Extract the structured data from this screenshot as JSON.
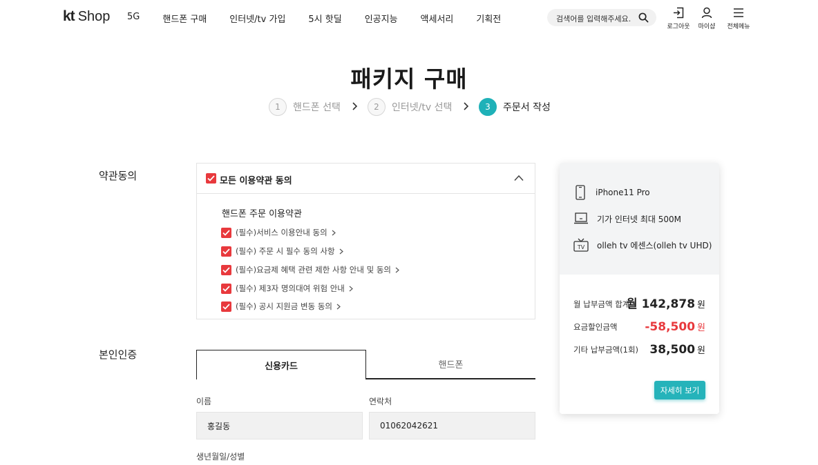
{
  "header": {
    "logo_mark": "kt",
    "logo_text": "Shop",
    "nav": [
      "5G",
      "핸드폰 구매",
      "인터넷/tv 가입",
      "5시 핫딜",
      "인공지능",
      "액세서리",
      "기획전"
    ],
    "search_placeholder": "검색어를 입력해주세요.",
    "util": {
      "logout": "로그아웃",
      "mypage": "마이샵",
      "menu": "전체메뉴"
    }
  },
  "page_title": "패키지 구매",
  "steps": [
    {
      "num": "1",
      "label": "핸드폰 선택",
      "active": false
    },
    {
      "num": "2",
      "label": "인터넷/tv 선택",
      "active": false
    },
    {
      "num": "3",
      "label": "주문서 작성",
      "active": true
    }
  ],
  "terms": {
    "section_label": "약관동의",
    "all_label": "모든 이용약관 동의",
    "group_title": "핸드폰 주문 이용약관",
    "items": [
      "(필수)서비스 이용안내 동의",
      "(필수) 주문 시 필수 동의 사항",
      "(필수)요금제 혜택 관련 제한 사항 안내 및 동의",
      "(필수) 제3자 명의대여 위험 안내",
      "(필수) 공시 지원금 변동 동의"
    ]
  },
  "auth": {
    "section_label": "본인인증",
    "tabs": [
      "신용카드",
      "핸드폰"
    ],
    "name_label": "이름",
    "name_value": "홍길동",
    "phone_label": "연락처",
    "phone_value": "01062042621",
    "birth_label": "생년월일/성별"
  },
  "summary": {
    "products": [
      {
        "icon": "phone-icon",
        "label": "iPhone11 Pro"
      },
      {
        "icon": "laptop-icon",
        "label": "기가 인터넷 최대 500M"
      },
      {
        "icon": "tv-icon",
        "label": "olleh tv 에센스(olleh tv UHD)"
      }
    ],
    "monthly_label": "월 납부금액 합계",
    "monthly_value": "월 142,878",
    "discount_label": "요금할인금액",
    "discount_value": "-58,500",
    "other_label": "기타 납부금액(1회)",
    "other_value": "38,500",
    "currency": "원",
    "detail_button": "자세히 보기"
  },
  "colors": {
    "accent": "#1fb1b8",
    "check": "#e8393d",
    "discount": "#e8393d"
  }
}
